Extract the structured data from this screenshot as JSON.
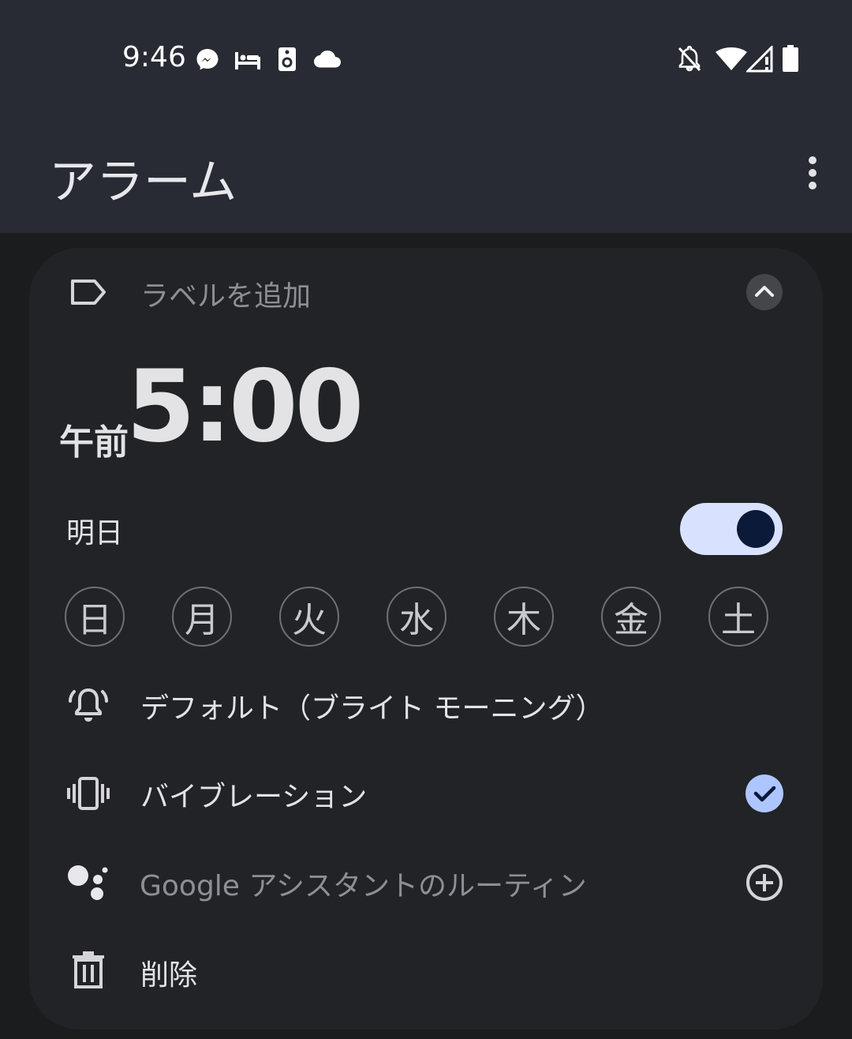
{
  "status_bar": {
    "time": "9:46",
    "left_icons": [
      "messenger-icon",
      "bed-icon",
      "speaker-icon",
      "cloud-icon"
    ],
    "right_icons": [
      "notifications-off-icon",
      "wifi-icon",
      "cell-signal-icon",
      "battery-icon"
    ]
  },
  "header": {
    "title": "アラーム",
    "menu_icon": "more-vert-icon"
  },
  "alarm": {
    "label_placeholder": "ラベルを追加",
    "ampm": "午前",
    "time": "5:00",
    "schedule_text": "明日",
    "enabled": true,
    "days": [
      "日",
      "月",
      "火",
      "水",
      "木",
      "金",
      "土"
    ],
    "ringtone": "デフォルト（ブライト モーニング）",
    "vibration_label": "バイブレーション",
    "vibration_checked": true,
    "assistant_label": "Google アシスタントのルーティン",
    "delete_label": "削除"
  },
  "colors": {
    "header_bg": "#282b33",
    "page_bg": "#1b1c1e",
    "card_bg": "#222327",
    "toggle_track": "#d8e2ff",
    "toggle_knob": "#0c1a3a",
    "accent": "#aec6ff"
  }
}
